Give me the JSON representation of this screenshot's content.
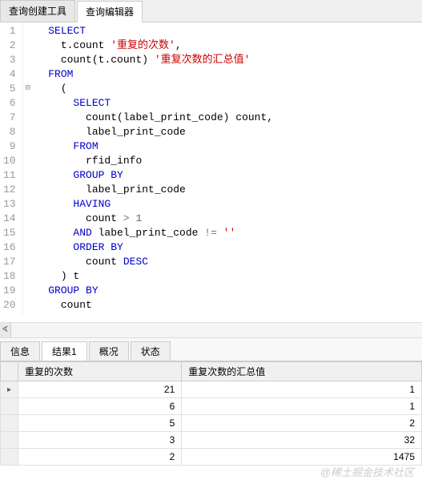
{
  "top_tabs": {
    "builder": "查询创建工具",
    "editor": "查询编辑器"
  },
  "code": {
    "lines": [
      {
        "n": 1,
        "ind": 1,
        "t": [
          {
            "c": "kw",
            "v": "SELECT"
          }
        ]
      },
      {
        "n": 2,
        "ind": 2,
        "t": [
          {
            "c": "id",
            "v": "t.count "
          },
          {
            "c": "str",
            "v": "'重复的次数'"
          },
          {
            "c": "id",
            "v": ","
          }
        ]
      },
      {
        "n": 3,
        "ind": 2,
        "t": [
          {
            "c": "fn",
            "v": "count"
          },
          {
            "c": "id",
            "v": "(t.count) "
          },
          {
            "c": "str",
            "v": "'重复次数的汇总值'"
          }
        ]
      },
      {
        "n": 4,
        "ind": 1,
        "t": [
          {
            "c": "kw",
            "v": "FROM"
          }
        ]
      },
      {
        "n": 5,
        "ind": 2,
        "fold": true,
        "t": [
          {
            "c": "id",
            "v": "("
          }
        ]
      },
      {
        "n": 6,
        "ind": 3,
        "t": [
          {
            "c": "kw",
            "v": "SELECT"
          }
        ]
      },
      {
        "n": 7,
        "ind": 4,
        "t": [
          {
            "c": "fn",
            "v": "count"
          },
          {
            "c": "id",
            "v": "(label_print_code) count,"
          }
        ]
      },
      {
        "n": 8,
        "ind": 4,
        "t": [
          {
            "c": "id",
            "v": "label_print_code"
          }
        ]
      },
      {
        "n": 9,
        "ind": 3,
        "t": [
          {
            "c": "kw",
            "v": "FROM"
          }
        ]
      },
      {
        "n": 10,
        "ind": 4,
        "t": [
          {
            "c": "id",
            "v": "rfid_info"
          }
        ]
      },
      {
        "n": 11,
        "ind": 3,
        "t": [
          {
            "c": "kw",
            "v": "GROUP BY"
          }
        ]
      },
      {
        "n": 12,
        "ind": 4,
        "t": [
          {
            "c": "id",
            "v": "label_print_code"
          }
        ]
      },
      {
        "n": 13,
        "ind": 3,
        "t": [
          {
            "c": "kw",
            "v": "HAVING"
          }
        ]
      },
      {
        "n": 14,
        "ind": 4,
        "t": [
          {
            "c": "id",
            "v": "count "
          },
          {
            "c": "op",
            "v": "> "
          },
          {
            "c": "num",
            "v": "1"
          }
        ]
      },
      {
        "n": 15,
        "ind": 3,
        "t": [
          {
            "c": "kw",
            "v": "AND"
          },
          {
            "c": "id",
            "v": " label_print_code "
          },
          {
            "c": "op",
            "v": "!= "
          },
          {
            "c": "str",
            "v": "''"
          }
        ]
      },
      {
        "n": 16,
        "ind": 3,
        "t": [
          {
            "c": "kw",
            "v": "ORDER BY"
          }
        ]
      },
      {
        "n": 17,
        "ind": 4,
        "t": [
          {
            "c": "id",
            "v": "count "
          },
          {
            "c": "kw",
            "v": "DESC"
          }
        ]
      },
      {
        "n": 18,
        "ind": 2,
        "t": [
          {
            "c": "id",
            "v": ") t"
          }
        ]
      },
      {
        "n": 19,
        "ind": 1,
        "t": [
          {
            "c": "kw",
            "v": "GROUP BY"
          }
        ]
      },
      {
        "n": 20,
        "ind": 2,
        "t": [
          {
            "c": "id",
            "v": "count"
          }
        ]
      }
    ]
  },
  "bottom_tabs": {
    "info": "信息",
    "result": "结果1",
    "profile": "概况",
    "status": "状态"
  },
  "result": {
    "columns": [
      "重复的次数",
      "重复次数的汇总值"
    ],
    "rows": [
      {
        "active": true,
        "cells": [
          "21",
          "1"
        ]
      },
      {
        "active": false,
        "cells": [
          "6",
          "1"
        ]
      },
      {
        "active": false,
        "cells": [
          "5",
          "2"
        ]
      },
      {
        "active": false,
        "cells": [
          "3",
          "32"
        ]
      },
      {
        "active": false,
        "cells": [
          "2",
          "1475"
        ]
      }
    ]
  },
  "watermark": "@稀土掘金技术社区"
}
